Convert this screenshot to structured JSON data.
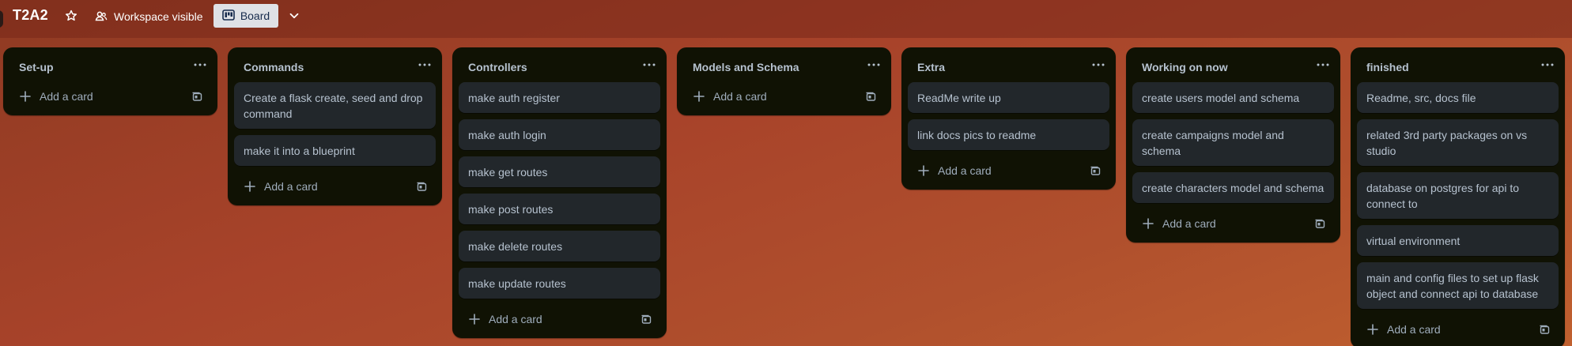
{
  "header": {
    "board_title": "T2A2",
    "visibility_label": "Workspace visible",
    "view_label": "Board",
    "icons": [
      "star-icon",
      "workspace-people-icon",
      "board-view-icon",
      "chevron-down-icon"
    ]
  },
  "add_card_label": "Add a card",
  "lists": [
    {
      "title": "Set-up",
      "cards": []
    },
    {
      "title": "Commands",
      "cards": [
        "Create a flask create, seed and drop command",
        "make it into a blueprint"
      ]
    },
    {
      "title": "Controllers",
      "cards": [
        "make auth register",
        "make auth login",
        "make get routes",
        "make post routes",
        "make delete routes",
        "make update routes"
      ]
    },
    {
      "title": "Models and Schema",
      "cards": []
    },
    {
      "title": "Extra",
      "cards": [
        "ReadMe write up",
        "link docs pics to readme"
      ]
    },
    {
      "title": "Working on now",
      "cards": [
        "create users model and schema",
        "create campaigns model and schema",
        "create characters model and schema"
      ]
    },
    {
      "title": "finished",
      "cards": [
        "Readme, src, docs file",
        "related 3rd party packages on vs studio",
        "database on postgres for api to connect to",
        "virtual environment",
        "main and config files to set up flask object and connect api to database"
      ]
    }
  ],
  "colors": {
    "background": "#a8432a",
    "list_bg": "#101204",
    "card_bg": "#22272b",
    "text": "#b6c2cf",
    "view_button_bg": "#dfe1e6"
  }
}
